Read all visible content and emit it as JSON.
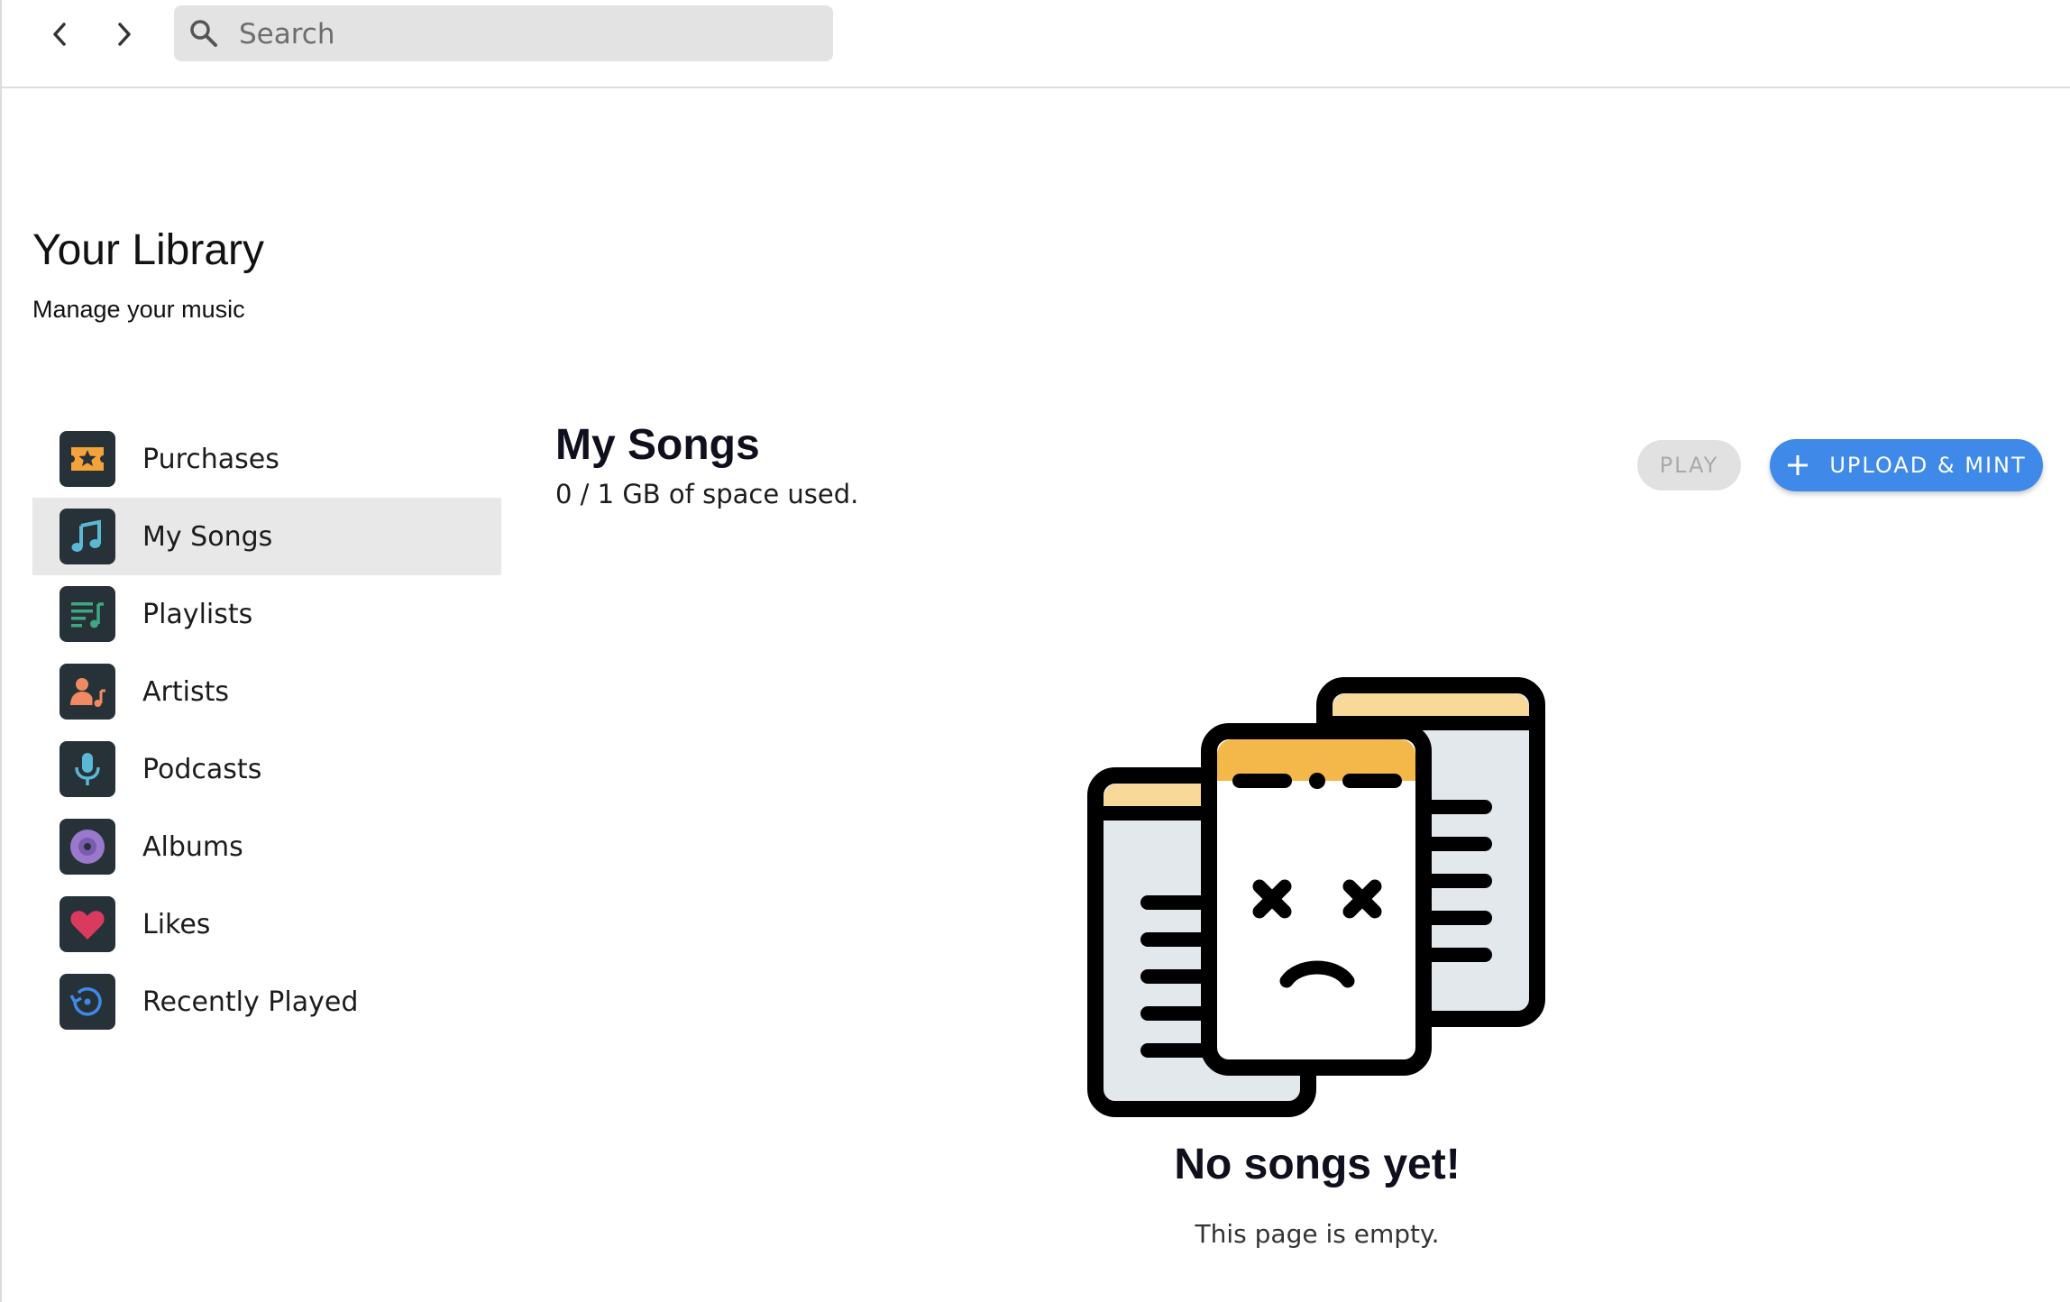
{
  "search": {
    "placeholder": "Search"
  },
  "library": {
    "title": "Your Library",
    "subtitle": "Manage your music"
  },
  "sidebar": {
    "items": [
      {
        "label": "Purchases",
        "icon": "ticket-star-icon",
        "color": "#f4a23a",
        "active": false
      },
      {
        "label": "My Songs",
        "icon": "music-note-icon",
        "color": "#5ab8d4",
        "active": true
      },
      {
        "label": "Playlists",
        "icon": "playlist-icon",
        "color": "#3fa883",
        "active": false
      },
      {
        "label": "Artists",
        "icon": "artist-icon",
        "color": "#f08a63",
        "active": false
      },
      {
        "label": "Podcasts",
        "icon": "microphone-icon",
        "color": "#5ab8d4",
        "active": false
      },
      {
        "label": "Albums",
        "icon": "album-disc-icon",
        "color": "#9a78cc",
        "active": false
      },
      {
        "label": "Likes",
        "icon": "heart-icon",
        "color": "#d93a5e",
        "active": false
      },
      {
        "label": "Recently Played",
        "icon": "history-icon",
        "color": "#3f8ae8",
        "active": false
      }
    ]
  },
  "main": {
    "title": "My Songs",
    "usage": "0 / 1 GB of space used.",
    "play_label": "PLAY",
    "upload_label": "UPLOAD & MINT"
  },
  "empty": {
    "title": "No songs yet!",
    "subtitle": "This page is empty."
  },
  "colors": {
    "accent": "#3f8ae8",
    "icon_bg": "#263238",
    "active_bg": "#e8e8e8"
  }
}
